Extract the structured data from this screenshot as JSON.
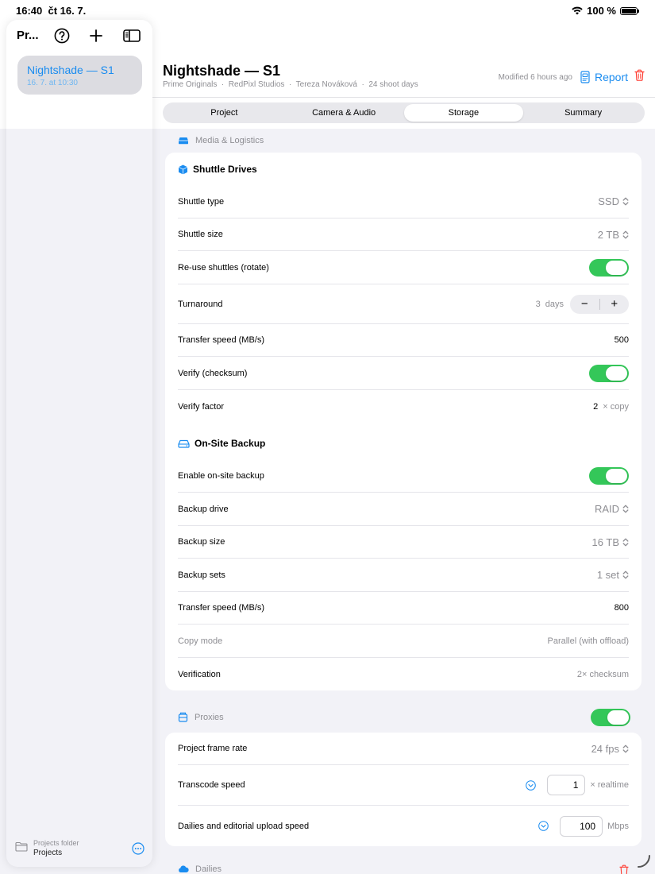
{
  "status": {
    "time": "16:40",
    "date": "čt 16. 7.",
    "battery": "100 %"
  },
  "sidebar": {
    "title": "Pr...",
    "project": {
      "name": "Nightshade — S1",
      "date": "16. 7. at 10:30"
    },
    "footer": {
      "label": "Projects folder",
      "name": "Projects"
    }
  },
  "header": {
    "title": "Nightshade — S1",
    "subtitle": "Prime Originals  ·  RedPixl Studios  ·  Tereza Nováková  ·  24 shoot days",
    "modified": "Modified 6 hours ago",
    "report": "Report"
  },
  "tabs": [
    "Project",
    "Camera & Audio",
    "Storage",
    "Summary"
  ],
  "media": {
    "title": "Media & Logistics",
    "shuttle": {
      "title": "Shuttle Drives",
      "shuttle_type": {
        "label": "Shuttle type",
        "value": "SSD"
      },
      "shuttle_size": {
        "label": "Shuttle size",
        "value": "2 TB"
      },
      "reuse": {
        "label": "Re-use shuttles (rotate)"
      },
      "turnaround": {
        "label": "Turnaround",
        "value": "3",
        "unit": "days",
        "minus": "−",
        "plus": "+"
      },
      "transfer": {
        "label": "Transfer speed (MB/s)",
        "value": "500"
      },
      "verify": {
        "label": "Verify (checksum)"
      },
      "verify_factor": {
        "label": "Verify factor",
        "value": "2",
        "unit": "× copy"
      }
    },
    "backup": {
      "title": "On-Site Backup",
      "enable": {
        "label": "Enable on-site backup"
      },
      "drive": {
        "label": "Backup drive",
        "value": "RAID"
      },
      "size": {
        "label": "Backup size",
        "value": "16 TB"
      },
      "sets": {
        "label": "Backup sets",
        "value": "1 set"
      },
      "transfer": {
        "label": "Transfer speed (MB/s)",
        "value": "800"
      },
      "copy_mode": {
        "label": "Copy mode",
        "value": "Parallel (with offload)"
      },
      "verification": {
        "label": "Verification",
        "value": "2× checksum"
      }
    }
  },
  "proxies": {
    "title": "Proxies",
    "frame_rate": {
      "label": "Project frame rate",
      "value": "24 fps"
    },
    "transcode": {
      "label": "Transcode speed",
      "value": "1",
      "unit": "× realtime"
    },
    "upload": {
      "label": "Dailies and editorial upload speed",
      "value": "100",
      "unit": "Mbps"
    }
  },
  "dailies": {
    "title": "Dailies"
  },
  "colors": {
    "accent": "#1a8cf0",
    "toggle_on": "#34c759",
    "destructive": "#ff3b30"
  }
}
